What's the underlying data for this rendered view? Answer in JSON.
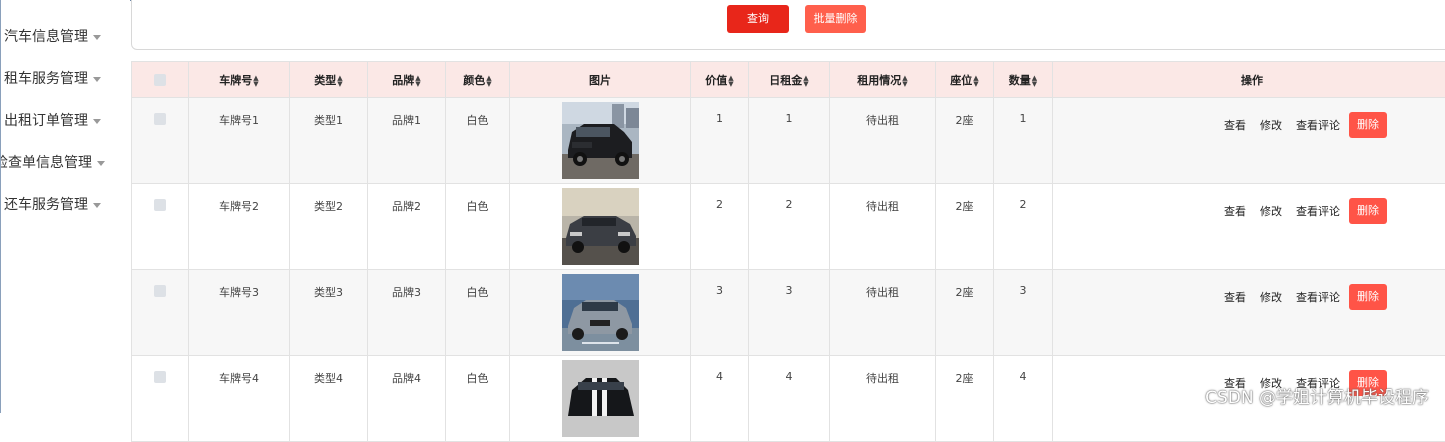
{
  "sidebar": {
    "items": [
      {
        "label": "汽车信息管理"
      },
      {
        "label": "租车服务管理"
      },
      {
        "label": "出租订单管理"
      },
      {
        "label": "检查单信息管理"
      },
      {
        "label": "还车服务管理"
      }
    ]
  },
  "search": {
    "query_label": "查询",
    "batch_delete_label": "批量删除"
  },
  "table": {
    "headers": {
      "plate": "车牌号",
      "type": "类型",
      "brand": "品牌",
      "color": "颜色",
      "image": "图片",
      "price": "价值",
      "daily_rent": "日租金",
      "rent_status": "租用情况",
      "seats": "座位",
      "quantity": "数量",
      "actions": "操作"
    },
    "actions": {
      "view": "查看",
      "edit": "修改",
      "view_comments": "查看评论",
      "delete": "删除"
    },
    "rows": [
      {
        "plate": "车牌号1",
        "type": "类型1",
        "brand": "品牌1",
        "color": "白色",
        "price": "1",
        "daily_rent": "1",
        "rent_status": "待出租",
        "seats": "2座",
        "quantity": "1"
      },
      {
        "plate": "车牌号2",
        "type": "类型2",
        "brand": "品牌2",
        "color": "白色",
        "price": "2",
        "daily_rent": "2",
        "rent_status": "待出租",
        "seats": "2座",
        "quantity": "2"
      },
      {
        "plate": "车牌号3",
        "type": "类型3",
        "brand": "品牌3",
        "color": "白色",
        "price": "3",
        "daily_rent": "3",
        "rent_status": "待出租",
        "seats": "2座",
        "quantity": "3"
      },
      {
        "plate": "车牌号4",
        "type": "类型4",
        "brand": "品牌4",
        "color": "白色",
        "price": "4",
        "daily_rent": "4",
        "rent_status": "待出租",
        "seats": "2座",
        "quantity": "4"
      }
    ]
  },
  "watermark": "CSDN @学姐计算机毕设程序",
  "colors": {
    "query_button": "#e8261a",
    "batch_delete_button": "#ff5f4c",
    "delete_button": "#ff5447",
    "header_bg": "#fbe8e6"
  }
}
